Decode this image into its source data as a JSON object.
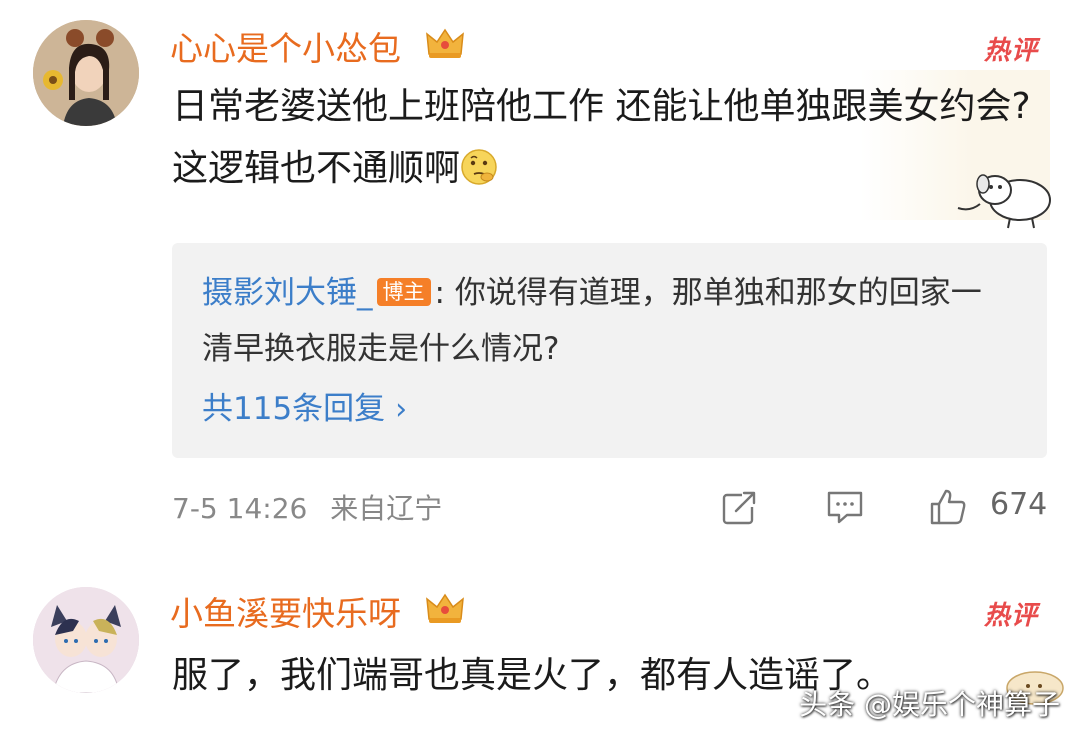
{
  "comments": [
    {
      "username": "心心是个小怂包",
      "hot_badge": "热评",
      "text": "日常老婆送他上班陪他工作 还能让他单独跟美女约会? 这逻辑也不通顺啊",
      "reply": {
        "author": "摄影刘大锤_",
        "author_tag": "博主",
        "separator": ": ",
        "text": "你说得有道理，那单独和那女的回家一清早换衣服走是什么情况?",
        "more_label": "共115条回复",
        "more_icon": "chevron-right-icon"
      },
      "timestamp": "7-5 14:26",
      "location": "来自辽宁",
      "like_count": "674",
      "icons": [
        "share-icon",
        "comment-icon",
        "like-icon",
        "crown-icon",
        "thinking-face-icon"
      ]
    },
    {
      "username": "小鱼溪要快乐呀",
      "hot_badge": "热评",
      "text": "服了，我们端哥也真是火了，都有人造谣了。"
    }
  ],
  "watermark": "头条 @娱乐个神算子",
  "colors": {
    "username": "#e86b1f",
    "link_blue": "#3c7ec9",
    "hot_red": "#e84b4b",
    "blogger_tag": "#f57f28",
    "reply_bg": "#f2f2f2"
  }
}
